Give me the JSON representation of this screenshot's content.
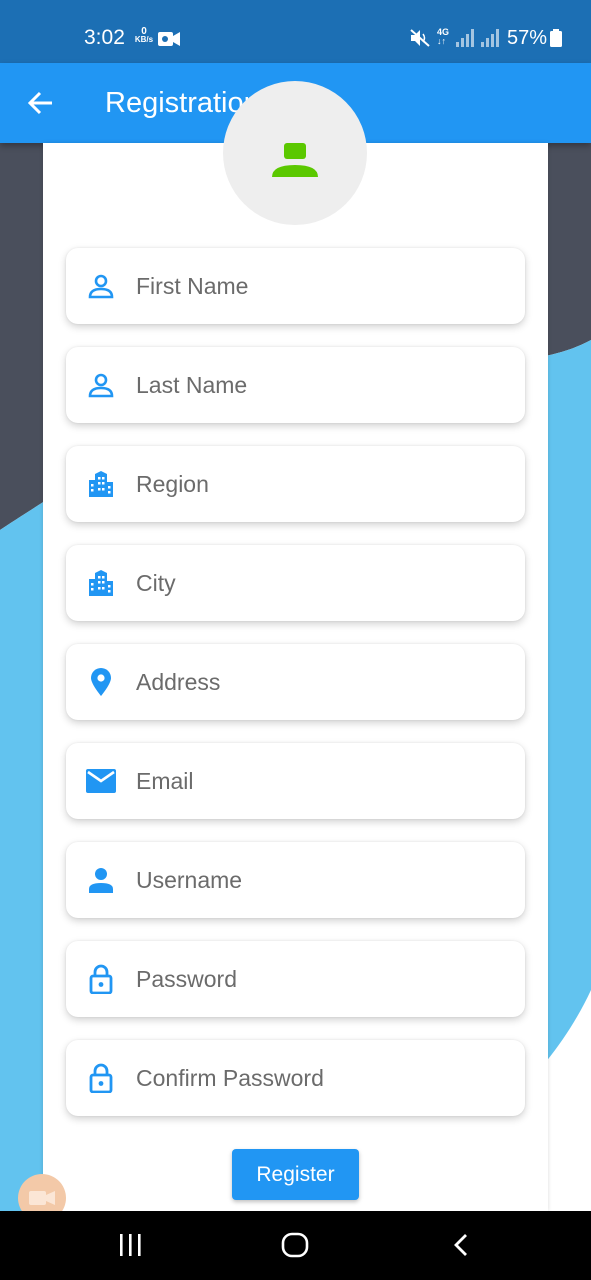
{
  "status_bar": {
    "time": "3:02",
    "data_rate_value": "0",
    "data_rate_unit": "KB/s",
    "network": "4G",
    "battery_percent": "57%"
  },
  "app_bar": {
    "title": "Registration",
    "back_icon": "arrow-back-icon"
  },
  "avatar": {
    "icon": "person-icon",
    "color": "#5bc800"
  },
  "form": {
    "fields": [
      {
        "placeholder": "First Name",
        "icon": "person-outline-icon"
      },
      {
        "placeholder": "Last Name",
        "icon": "person-outline-icon"
      },
      {
        "placeholder": "Region",
        "icon": "location-city-icon"
      },
      {
        "placeholder": "City",
        "icon": "location-city-icon"
      },
      {
        "placeholder": "Address",
        "icon": "location-pin-icon"
      },
      {
        "placeholder": "Email",
        "icon": "email-icon"
      },
      {
        "placeholder": "Username",
        "icon": "person-icon"
      },
      {
        "placeholder": "Password",
        "icon": "lock-outline-icon"
      },
      {
        "placeholder": "Confirm Password",
        "icon": "lock-outline-icon"
      }
    ],
    "register_label": "Register"
  },
  "colors": {
    "status_bar": "#1c6fb4",
    "app_bar": "#2196f3",
    "accent": "#2196f3",
    "bg_dark": "#4a4f5c",
    "bg_light_blue": "#62c3ef"
  },
  "nav_bar": {
    "buttons": [
      "recent-apps-icon",
      "home-icon",
      "back-icon"
    ]
  }
}
